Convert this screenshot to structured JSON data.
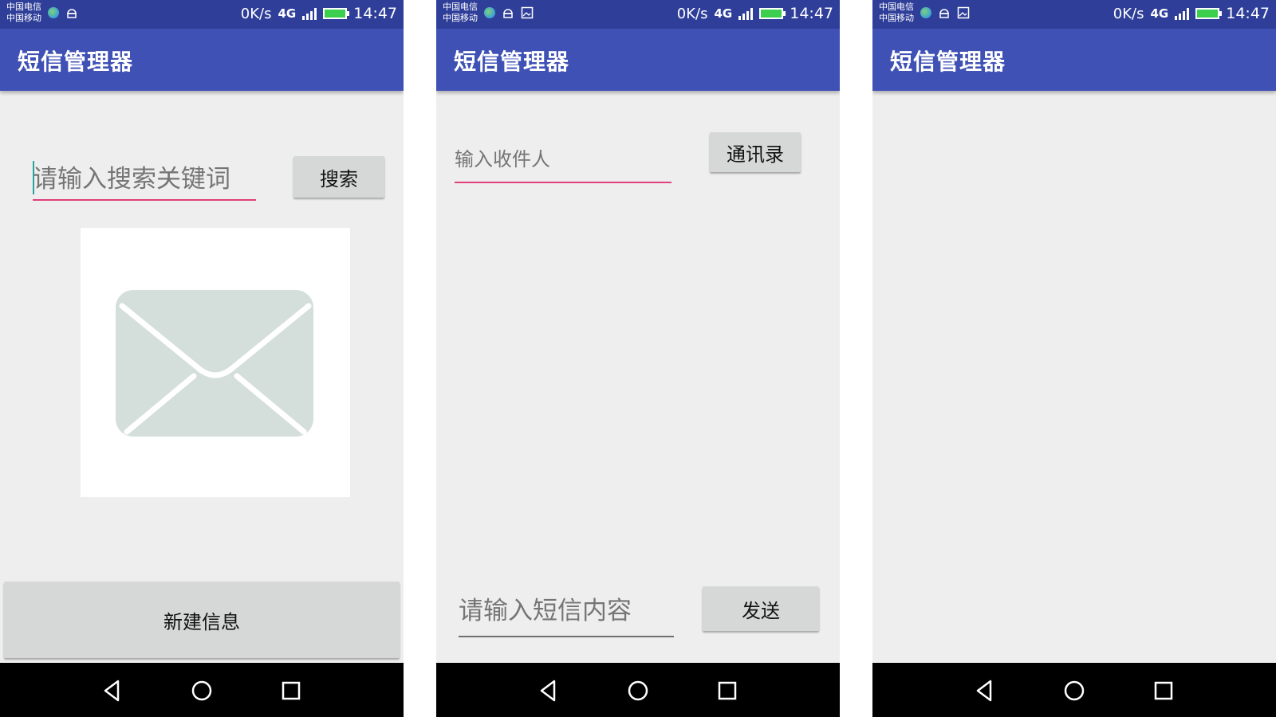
{
  "screens": [
    {
      "status_bar": {
        "carrier_1": "中国电信",
        "carrier_2": "中国移动",
        "net_speed": "0K/s",
        "network_type": "4G",
        "time": "14:47"
      },
      "app_title": "短信管理器",
      "search": {
        "placeholder": "请输入搜索关键词",
        "button_label": "搜索"
      },
      "new_message_button": "新建信息"
    },
    {
      "status_bar": {
        "carrier_1": "中国电信",
        "carrier_2": "中国移动",
        "net_speed": "0K/s",
        "network_type": "4G",
        "time": "14:47"
      },
      "app_title": "短信管理器",
      "recipient": {
        "placeholder": "输入收件人",
        "contacts_button": "通讯录"
      },
      "message": {
        "placeholder": "请输入短信内容",
        "send_button": "发送"
      }
    },
    {
      "status_bar": {
        "carrier_1": "中国电信",
        "carrier_2": "中国移动",
        "net_speed": "0K/s",
        "network_type": "4G",
        "time": "14:47"
      },
      "app_title": "短信管理器"
    }
  ],
  "colors": {
    "status_bar": "#2f3f99",
    "app_bar": "#3f51b5",
    "accent": "#e0407b",
    "background": "#eeeeee",
    "button": "#d6d7d7"
  }
}
